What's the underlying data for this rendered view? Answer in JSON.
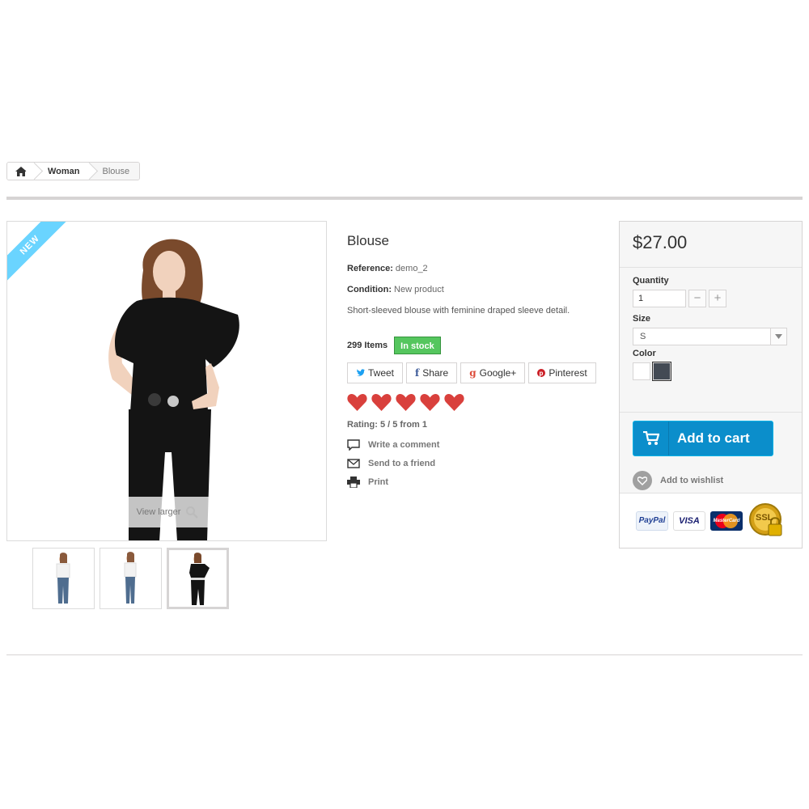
{
  "breadcrumb": {
    "items": [
      "Woman",
      "Blouse"
    ]
  },
  "product": {
    "badge": "NEW",
    "view_larger": "View larger",
    "title": "Blouse",
    "reference_label": "Reference:",
    "reference_value": "demo_2",
    "condition_label": "Condition:",
    "condition_value": "New product",
    "description": "Short-sleeved blouse with feminine draped sleeve detail.",
    "items_count": "299 Items",
    "stock_status": "In stock",
    "rating_value": 5,
    "rating_max": 5,
    "rating_text": "Rating: 5 / 5 from 1"
  },
  "social": {
    "tweet": "Tweet",
    "share": "Share",
    "google": "Google+",
    "pinterest": "Pinterest"
  },
  "actions": {
    "comment": "Write a comment",
    "send": "Send to a friend",
    "print": "Print"
  },
  "buy": {
    "price": "$27.00",
    "quantity_label": "Quantity",
    "quantity_value": "1",
    "size_label": "Size",
    "size_value": "S",
    "color_label": "Color",
    "colors": [
      "#ffffff",
      "#434a54"
    ],
    "add_to_cart": "Add to cart",
    "wishlist": "Add to wishlist"
  },
  "payment": {
    "paypal": "PayPal",
    "visa": "VISA",
    "mastercard": "MasterCard",
    "ssl": "SSL"
  },
  "colors": {
    "accent_blue": "#0b8ecb",
    "ribbon": "#6ad4ff",
    "stock_green": "#55c65e",
    "heart_red": "#d9403c"
  }
}
